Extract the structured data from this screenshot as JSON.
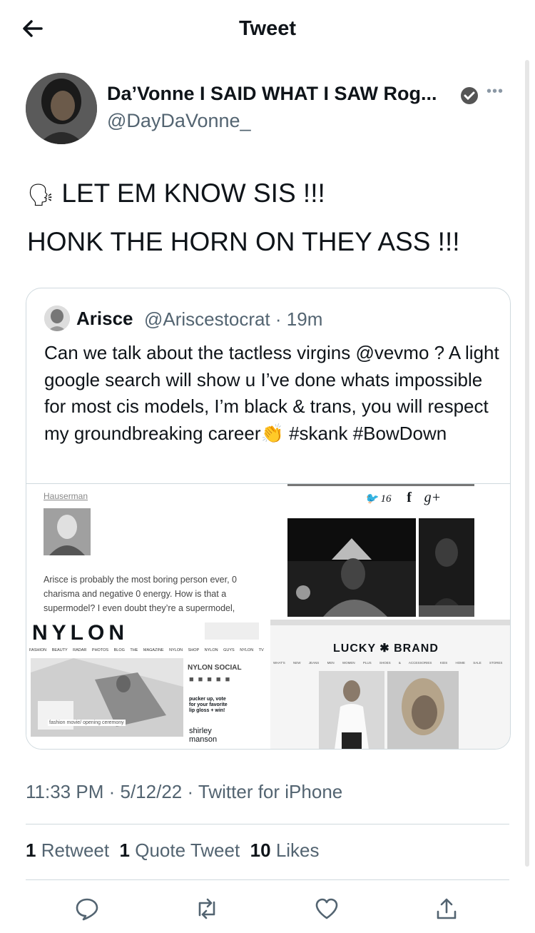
{
  "header": {
    "title": "Tweet",
    "back_icon": "arrow-left-icon"
  },
  "author": {
    "name": "Da’Vonne I SAID WHAT I SAW Rog...",
    "handle": "@DayDaVonne_",
    "verified_icon": "verified-badge-icon",
    "more_icon": "more-icon"
  },
  "tweet": {
    "line1_emoji": "🗣",
    "line1": "LET EM KNOW SIS !!!",
    "line2": "HONK THE HORN ON THEY ASS !!!"
  },
  "quote": {
    "name": "Arisce",
    "handle": "@Ariscestocrat",
    "separator": "·",
    "time": "19m",
    "text": "Can we talk about the tactless virgins @vevmo ? A light google search will show u I’ve done whats impossible for most cis models, I’m black & trans, you will respect my groundbreaking career👏 #skank #BowDown",
    "images": {
      "img1": {
        "link": "Hauserman",
        "caption": "Arisce is probably the most boring person ever, 0 charisma and negative 0 energy. How is that a supermodel? I even doubt they’re a supermodel,"
      },
      "img2": {
        "count": "16",
        "f": "f",
        "g": "g+"
      },
      "img3": {
        "logo": "NYLON",
        "nav": [
          "FASHION",
          "BEAUTY",
          "RADAR",
          "PHOTOS",
          "BLOG",
          "THE MAGAZINE",
          "NYLON SHOP",
          "NYLON GUYS",
          "NYLON TV"
        ],
        "social": "NYLON SOCIAL",
        "promo": "pucker up, vote for your favorite lip gloss + win!",
        "shirley": "shirley manson",
        "caption": "fashion movie/ opening ceremony"
      },
      "img4": {
        "logo": "LUCKY",
        "logo2": "BRAND",
        "nav": [
          "WHAT'S NEW",
          "JEANS",
          "MEN",
          "WOMEN",
          "PLUS",
          "SHOES & ACCESSORIES",
          "KIDS",
          "HOME",
          "SALE",
          "STORES"
        ]
      }
    }
  },
  "meta": {
    "time": "11:33 PM",
    "date": "5/12/22",
    "source": "Twitter for iPhone",
    "sep": "·"
  },
  "stats": {
    "retweets": "1",
    "retweets_label": "Retweet",
    "quotes": "1",
    "quotes_label": "Quote Tweet",
    "likes": "10",
    "likes_label": "Likes"
  },
  "actions": [
    "reply-icon",
    "retweet-icon",
    "like-icon",
    "share-icon"
  ]
}
